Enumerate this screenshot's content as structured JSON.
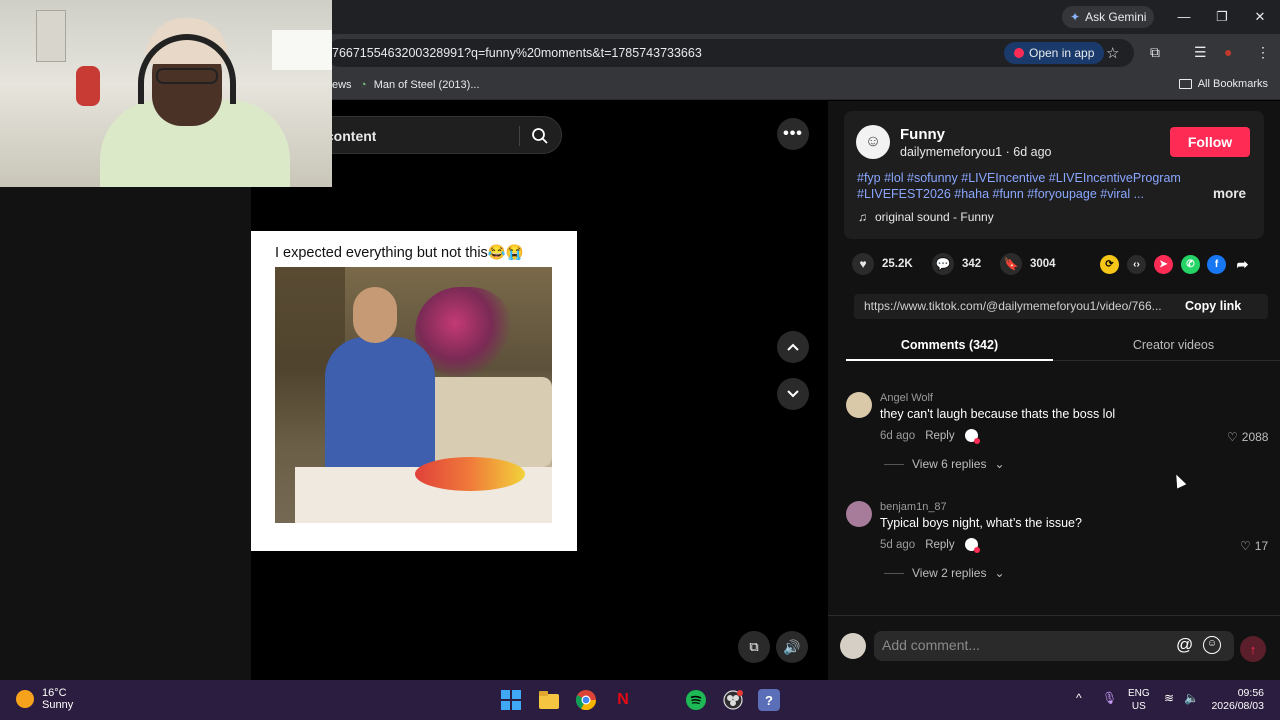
{
  "browser": {
    "ask_gemini": "Ask Gemini",
    "url": "7667155463200328991?q=funny%20moments&t=1785743733663",
    "open_in_app": "Open in app",
    "bookmarks": [
      "ews",
      "Man of Steel (2013)..."
    ],
    "all_bookmarks": "All Bookmarks"
  },
  "search": {
    "text": "ted content"
  },
  "video": {
    "caption": "I expected everything but not this😂😭"
  },
  "post": {
    "creator_name": "Funny",
    "handle": "dailymemeforyou1 · 6d ago",
    "follow": "Follow",
    "hashtags": "#fyp #lol #sofunny #LIVEIncentive #LIVEIncentiveProgram #LIVEFEST2026 #haha #funn #foryoupage #viral ...",
    "more": "more",
    "sound": "original sound - Funny",
    "likes": "25.2K",
    "comments_count": "342",
    "saves": "3004",
    "link": "https://www.tiktok.com/@dailymemeforyou1/video/766...",
    "copy_link": "Copy link"
  },
  "tabs": {
    "comments": "Comments (342)",
    "creator_videos": "Creator videos"
  },
  "comments": [
    {
      "user": "Angel Wolf",
      "text": "they can't laugh because thats the boss lol",
      "age": "6d ago",
      "reply": "Reply",
      "likes": "2088",
      "view_replies": "View 6 replies",
      "avatar_color": "#d9c9a8"
    },
    {
      "user": "benjam1n_87",
      "text": "Typical boys night, what’s the issue?",
      "age": "5d ago",
      "reply": "Reply",
      "likes": "17",
      "view_replies": "View 2 replies",
      "avatar_color": "#a77b9a"
    }
  ],
  "comment_input": {
    "placeholder": "Add comment..."
  },
  "taskbar": {
    "temp": "16°C",
    "condition": "Sunny",
    "lang_top": "ENG",
    "lang_bottom": "US",
    "time": "09:56",
    "date": "2026/08/03"
  },
  "colors": {
    "accent": "#fe2c55",
    "hashtag": "#8aa6ff",
    "taskbar": "#2b1d3f"
  }
}
